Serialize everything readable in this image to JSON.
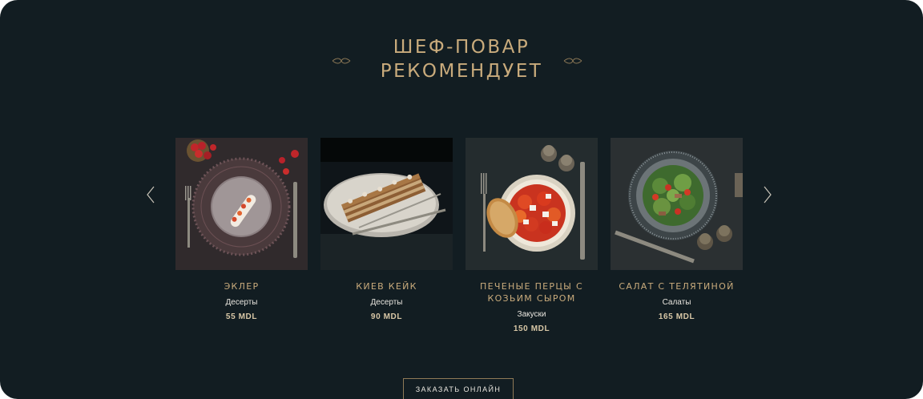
{
  "section": {
    "title_line1": "ШЕФ-ПОВАР",
    "title_line2": "РЕКОМЕНДУЕТ"
  },
  "carousel": {
    "prev_icon": "chevron-left-icon",
    "next_icon": "chevron-right-icon"
  },
  "dishes": [
    {
      "name": "ЭКЛЕР",
      "category": "Десерты",
      "price": "55 MDL"
    },
    {
      "name": "КИЕВ КЕЙК",
      "category": "Десерты",
      "price": "90 MDL"
    },
    {
      "name": "ПЕЧЕНЫЕ ПЕРЦЫ С КОЗЬИМ СЫРОМ",
      "category": "Закуски",
      "price": "150 MDL"
    },
    {
      "name": "САЛАТ С ТЕЛЯТИНОЙ",
      "category": "Салаты",
      "price": "165 MDL"
    }
  ],
  "cta": {
    "order_label": "ЗАКАЗАТЬ ОНЛАЙН"
  },
  "colors": {
    "background": "#121d22",
    "accent_gold": "#c9ab7c",
    "text_light": "#e9e6df"
  }
}
